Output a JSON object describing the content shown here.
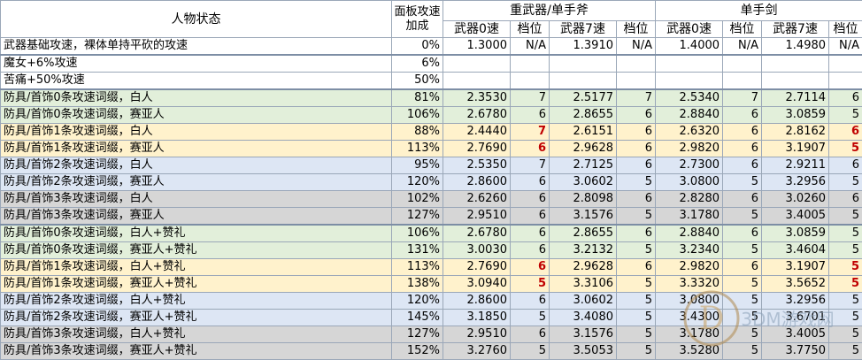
{
  "headers": {
    "status": "人物状态",
    "panel_speed": "面板攻速加成",
    "heavy_group": "重武器/单手斧",
    "sword_group": "单手剑",
    "weapon0": "武器0速",
    "gear": "档位",
    "weapon7": "武器7速"
  },
  "rows": [
    {
      "label": "武器基础攻速，裸体单持平砍的攻速",
      "pct": "0%",
      "h0": "1.3000",
      "hg0": "N/A",
      "h7": "1.3910",
      "hg7": "N/A",
      "s0": "1.4000",
      "sg0": "N/A",
      "s7": "1.4980",
      "sg7": "N/A",
      "group": "white"
    },
    {
      "label": "魔女+6%攻速",
      "pct": "6%",
      "h0": "",
      "hg0": "",
      "h7": "",
      "hg7": "",
      "s0": "",
      "sg0": "",
      "s7": "",
      "sg7": "",
      "group": "white"
    },
    {
      "label": "苦痛+50%攻速",
      "pct": "50%",
      "h0": "",
      "hg0": "",
      "h7": "",
      "hg7": "",
      "s0": "",
      "sg0": "",
      "s7": "",
      "sg7": "",
      "group": "white"
    },
    {
      "label": "防具/首饰0条攻速词缀，白人",
      "pct": "81%",
      "h0": "2.3530",
      "hg0": "7",
      "h7": "2.5177",
      "hg7": "7",
      "s0": "2.5340",
      "sg0": "7",
      "s7": "2.7114",
      "sg7": "6",
      "group": "green"
    },
    {
      "label": "防具/首饰0条攻速词缀，赛亚人",
      "pct": "106%",
      "h0": "2.6780",
      "hg0": "6",
      "h7": "2.8655",
      "hg7": "6",
      "s0": "2.8840",
      "sg0": "6",
      "s7": "3.0859",
      "sg7": "5",
      "group": "green"
    },
    {
      "label": "防具/首饰1条攻速词缀，白人",
      "pct": "88%",
      "h0": "2.4440",
      "hg0": "7",
      "h7": "2.6151",
      "hg7": "6",
      "s0": "2.6320",
      "sg0": "6",
      "s7": "2.8162",
      "sg7": "6",
      "group": "yellow",
      "red_hg0": true,
      "red_sg7": true
    },
    {
      "label": "防具/首饰1条攻速词缀，赛亚人",
      "pct": "113%",
      "h0": "2.7690",
      "hg0": "6",
      "h7": "2.9628",
      "hg7": "6",
      "s0": "2.9820",
      "sg0": "6",
      "s7": "3.1907",
      "sg7": "5",
      "group": "yellow",
      "red_hg0": true,
      "red_sg7": true
    },
    {
      "label": "防具/首饰2条攻速词缀，白人",
      "pct": "95%",
      "h0": "2.5350",
      "hg0": "7",
      "h7": "2.7125",
      "hg7": "6",
      "s0": "2.7300",
      "sg0": "6",
      "s7": "2.9211",
      "sg7": "6",
      "group": "blue"
    },
    {
      "label": "防具/首饰2条攻速词缀，赛亚人",
      "pct": "120%",
      "h0": "2.8600",
      "hg0": "6",
      "h7": "3.0602",
      "hg7": "5",
      "s0": "3.0800",
      "sg0": "5",
      "s7": "3.2956",
      "sg7": "5",
      "group": "blue"
    },
    {
      "label": "防具/首饰3条攻速词缀，白人",
      "pct": "102%",
      "h0": "2.6260",
      "hg0": "6",
      "h7": "2.8098",
      "hg7": "6",
      "s0": "2.8280",
      "sg0": "6",
      "s7": "3.0260",
      "sg7": "6",
      "group": "gray"
    },
    {
      "label": "防具/首饰3条攻速词缀，赛亚人",
      "pct": "127%",
      "h0": "2.9510",
      "hg0": "6",
      "h7": "3.1576",
      "hg7": "5",
      "s0": "3.1780",
      "sg0": "5",
      "s7": "3.4005",
      "sg7": "5",
      "group": "gray"
    },
    {
      "label": "防具/首饰0条攻速词缀，白人+赞礼",
      "pct": "106%",
      "h0": "2.6780",
      "hg0": "6",
      "h7": "2.8655",
      "hg7": "6",
      "s0": "2.8840",
      "sg0": "6",
      "s7": "3.0859",
      "sg7": "5",
      "group": "green"
    },
    {
      "label": "防具/首饰0条攻速词缀，赛亚人+赞礼",
      "pct": "131%",
      "h0": "3.0030",
      "hg0": "6",
      "h7": "3.2132",
      "hg7": "5",
      "s0": "3.2340",
      "sg0": "5",
      "s7": "3.4604",
      "sg7": "5",
      "group": "green"
    },
    {
      "label": "防具/首饰1条攻速词缀，白人+赞礼",
      "pct": "113%",
      "h0": "2.7690",
      "hg0": "6",
      "h7": "2.9628",
      "hg7": "6",
      "s0": "2.9820",
      "sg0": "6",
      "s7": "3.1907",
      "sg7": "5",
      "group": "yellow",
      "red_hg0": true,
      "red_sg7": true
    },
    {
      "label": "防具/首饰1条攻速词缀，赛亚人+赞礼",
      "pct": "138%",
      "h0": "3.0940",
      "hg0": "5",
      "h7": "3.3106",
      "hg7": "5",
      "s0": "3.3320",
      "sg0": "5",
      "s7": "3.5652",
      "sg7": "5",
      "group": "yellow",
      "red_hg0": true,
      "red_sg7": true
    },
    {
      "label": "防具/首饰2条攻速词缀，白人+赞礼",
      "pct": "120%",
      "h0": "2.8600",
      "hg0": "6",
      "h7": "3.0602",
      "hg7": "5",
      "s0": "3.0800",
      "sg0": "5",
      "s7": "3.2956",
      "sg7": "5",
      "group": "blue"
    },
    {
      "label": "防具/首饰2条攻速词缀，赛亚人+赞礼",
      "pct": "145%",
      "h0": "3.1850",
      "hg0": "5",
      "h7": "3.4080",
      "hg7": "5",
      "s0": "3.4300",
      "sg0": "5",
      "s7": "3.6701",
      "sg7": "5",
      "group": "blue"
    },
    {
      "label": "防具/首饰3条攻速词缀，白人+赞礼",
      "pct": "127%",
      "h0": "2.9510",
      "hg0": "6",
      "h7": "3.1576",
      "hg7": "5",
      "s0": "3.1780",
      "sg0": "5",
      "s7": "3.4005",
      "sg7": "5",
      "group": "gray"
    },
    {
      "label": "防具/首饰3条攻速词缀，赛亚人+赞礼",
      "pct": "152%",
      "h0": "3.2760",
      "hg0": "5",
      "h7": "3.5053",
      "hg7": "5",
      "s0": "3.5280",
      "sg0": "5",
      "s7": "3.7750",
      "sg7": "5",
      "group": "gray"
    }
  ],
  "watermark": {
    "glyph": "D",
    "text": "3DM游戏网"
  },
  "colors": {
    "red_highlight": "#c00000",
    "green": "#e2efda",
    "yellow": "#fff2cc",
    "blue": "#dde6f4",
    "gray": "#d6d6d6"
  }
}
